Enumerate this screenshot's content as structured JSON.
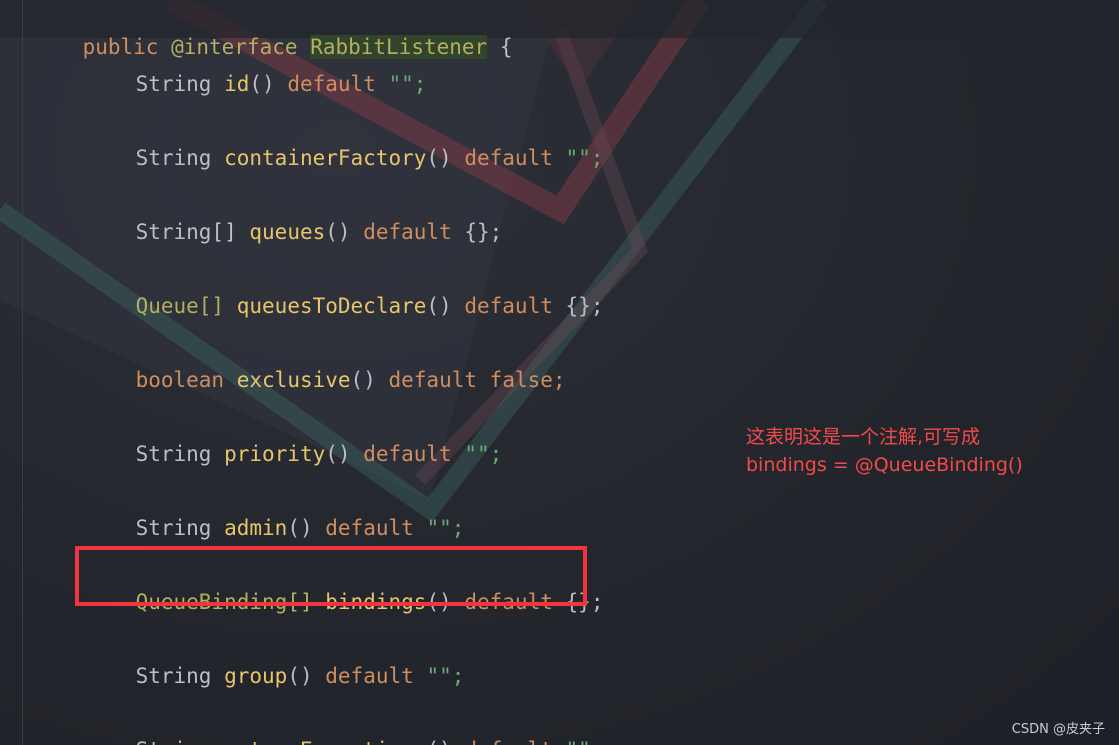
{
  "declaration": {
    "modifier": "public",
    "keyword": "@interface",
    "name": "RabbitListener",
    "brace": "{"
  },
  "members": [
    {
      "type": "String",
      "name": "id",
      "parens": "()",
      "default_kw": "default",
      "value": "\"\";"
    },
    {
      "type": "String",
      "name": "containerFactory",
      "parens": "()",
      "default_kw": "default",
      "value": "\"\";"
    },
    {
      "type": "String[]",
      "name": "queues",
      "parens": "()",
      "default_kw": "default",
      "value": "{};"
    },
    {
      "type": "Queue[]",
      "name": "queuesToDeclare",
      "parens": "()",
      "default_kw": "default",
      "value": "{};"
    },
    {
      "type": "boolean",
      "name": "exclusive",
      "parens": "()",
      "default_kw": "default",
      "value": "false;"
    },
    {
      "type": "String",
      "name": "priority",
      "parens": "()",
      "default_kw": "default",
      "value": "\"\";"
    },
    {
      "type": "String",
      "name": "admin",
      "parens": "()",
      "default_kw": "default",
      "value": "\"\";"
    },
    {
      "type": "QueueBinding[]",
      "name": "bindings",
      "parens": "()",
      "default_kw": "default",
      "value": "{};"
    },
    {
      "type": "String",
      "name": "group",
      "parens": "()",
      "default_kw": "default",
      "value": "\"\";"
    },
    {
      "type": "String",
      "name": "returnExceptions",
      "parens": "()",
      "default_kw": "default",
      "value": "\"\";"
    }
  ],
  "annotation_note": {
    "line1": "这表明这是一个注解,可写成",
    "line2": "bindings = @QueueBinding()"
  },
  "watermark": "CSDN @皮夹子",
  "colors": {
    "keyword": "#cf8e5f",
    "method": "#e8c46a",
    "class_type": "#b3ae60",
    "plain": "#bcbec4",
    "highlight_box": "#f0353e",
    "note_text": "#f24a4a"
  }
}
